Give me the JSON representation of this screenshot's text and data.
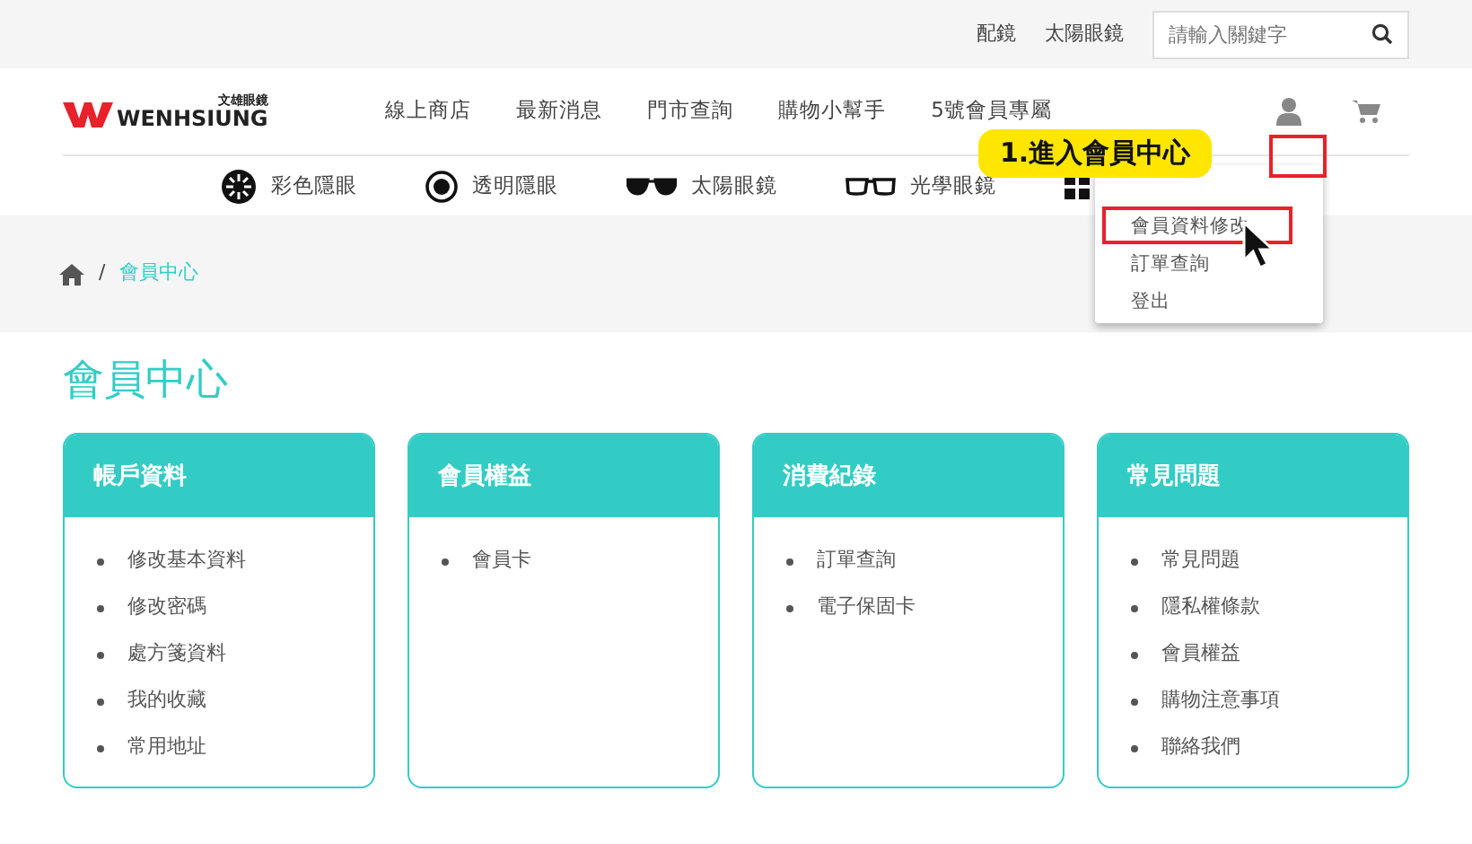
{
  "top_bar": {
    "links": [
      "配鏡",
      "太陽眼鏡"
    ],
    "search": {
      "placeholder": "請輸入關鍵字"
    }
  },
  "header": {
    "logo": {
      "brand": "WENHSIUNG",
      "subtitle": "文雄眼鏡"
    },
    "nav": [
      "線上商店",
      "最新消息",
      "門市查詢",
      "購物小幫手",
      "5號會員專屬"
    ]
  },
  "categories": [
    {
      "kind": "colorlens",
      "label": "彩色隱眼"
    },
    {
      "kind": "clearlens",
      "label": "透明隱眼"
    },
    {
      "kind": "sunglasses",
      "label": "太陽眼鏡"
    },
    {
      "kind": "optical",
      "label": "光學眼鏡"
    },
    {
      "kind": "grid"
    }
  ],
  "callout": {
    "text": "1.進入會員中心"
  },
  "account_menu": [
    {
      "label": "會員資料修改",
      "highlighted": true
    },
    {
      "label": "訂單查詢",
      "highlighted": false
    },
    {
      "label": "登出",
      "highlighted": false
    }
  ],
  "breadcrumb": {
    "separator": "/",
    "items": [
      "會員中心"
    ]
  },
  "page_title": "會員中心",
  "cards": [
    {
      "title": "帳戶資料",
      "items": [
        "修改基本資料",
        "修改密碼",
        "處方箋資料",
        "我的收藏",
        "常用地址"
      ]
    },
    {
      "title": "會員權益",
      "items": [
        "會員卡"
      ]
    },
    {
      "title": "消費紀錄",
      "items": [
        "訂單查詢",
        "電子保固卡"
      ]
    },
    {
      "title": "常見問題",
      "items": [
        "常見問題",
        "隱私權條款",
        "會員權益",
        "購物注意事項",
        "聯絡我們"
      ]
    }
  ]
}
